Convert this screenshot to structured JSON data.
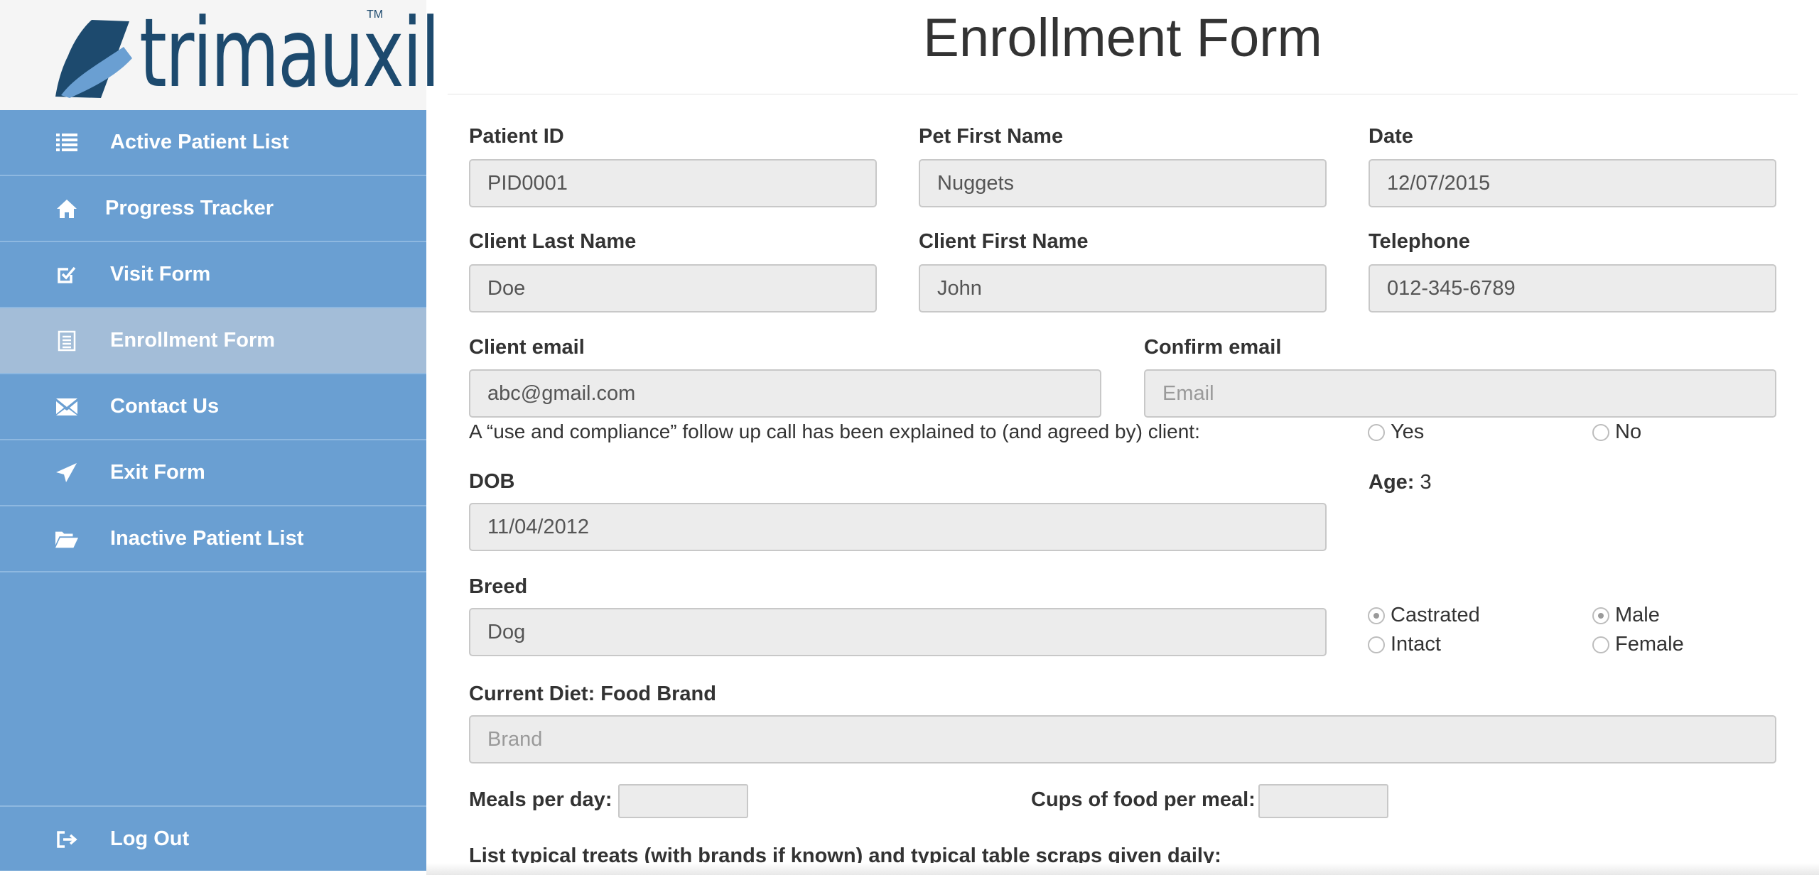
{
  "brand": {
    "logo_text": "trimauxil",
    "trademark": "TM"
  },
  "nav": {
    "items": [
      {
        "label": "Active Patient List",
        "icon": "list-icon"
      },
      {
        "label": "Progress Tracker",
        "icon": "home-icon"
      },
      {
        "label": "Visit Form",
        "icon": "check-square-icon"
      },
      {
        "label": "Enrollment Form",
        "icon": "document-icon",
        "active": true
      },
      {
        "label": "Contact Us",
        "icon": "envelope-icon"
      },
      {
        "label": "Exit Form",
        "icon": "send-icon"
      },
      {
        "label": "Inactive Patient List",
        "icon": "folder-open-icon"
      }
    ],
    "logout": {
      "label": "Log Out",
      "icon": "logout-icon"
    }
  },
  "page": {
    "title": "Enrollment Form"
  },
  "form": {
    "patient_id": {
      "label": "Patient ID",
      "value": "PID0001"
    },
    "pet_first_name": {
      "label": "Pet First Name",
      "value": "Nuggets"
    },
    "date": {
      "label": "Date",
      "value": "12/07/2015"
    },
    "client_last_name": {
      "label": "Client Last Name",
      "value": "Doe"
    },
    "client_first_name": {
      "label": "Client First Name",
      "value": "John"
    },
    "telephone": {
      "label": "Telephone",
      "value": "012-345-6789"
    },
    "client_email": {
      "label": "Client email",
      "value": "abc@gmail.com"
    },
    "confirm_email": {
      "label": "Confirm email",
      "value": "",
      "placeholder": "Email"
    },
    "follow_up": {
      "question": "A “use and compliance” follow up call has been explained to (and agreed by) client:",
      "yes_label": "Yes",
      "no_label": "No",
      "selected": ""
    },
    "dob": {
      "label": "DOB",
      "value": "11/04/2012"
    },
    "age": {
      "label": "Age:",
      "value": "3"
    },
    "breed": {
      "label": "Breed",
      "value": "Dog"
    },
    "neuter_status": {
      "castrated_label": "Castrated",
      "intact_label": "Intact",
      "selected": "Castrated"
    },
    "sex": {
      "male_label": "Male",
      "female_label": "Female",
      "selected": "Male"
    },
    "food_brand": {
      "label": "Current Diet: Food Brand",
      "value": "",
      "placeholder": "Brand"
    },
    "meals_per_day": {
      "label": "Meals per day:",
      "value": ""
    },
    "cups_per_meal": {
      "label": "Cups of food per meal:",
      "value": ""
    },
    "treats": {
      "label": "List typical treats (with brands if known) and typical table scraps given daily:"
    }
  },
  "colors": {
    "sidebar": "#6a9fd2",
    "sidebar_active": "#a3bdd8",
    "logo_blue": "#1d4a6e",
    "field_bg": "#ececec"
  }
}
